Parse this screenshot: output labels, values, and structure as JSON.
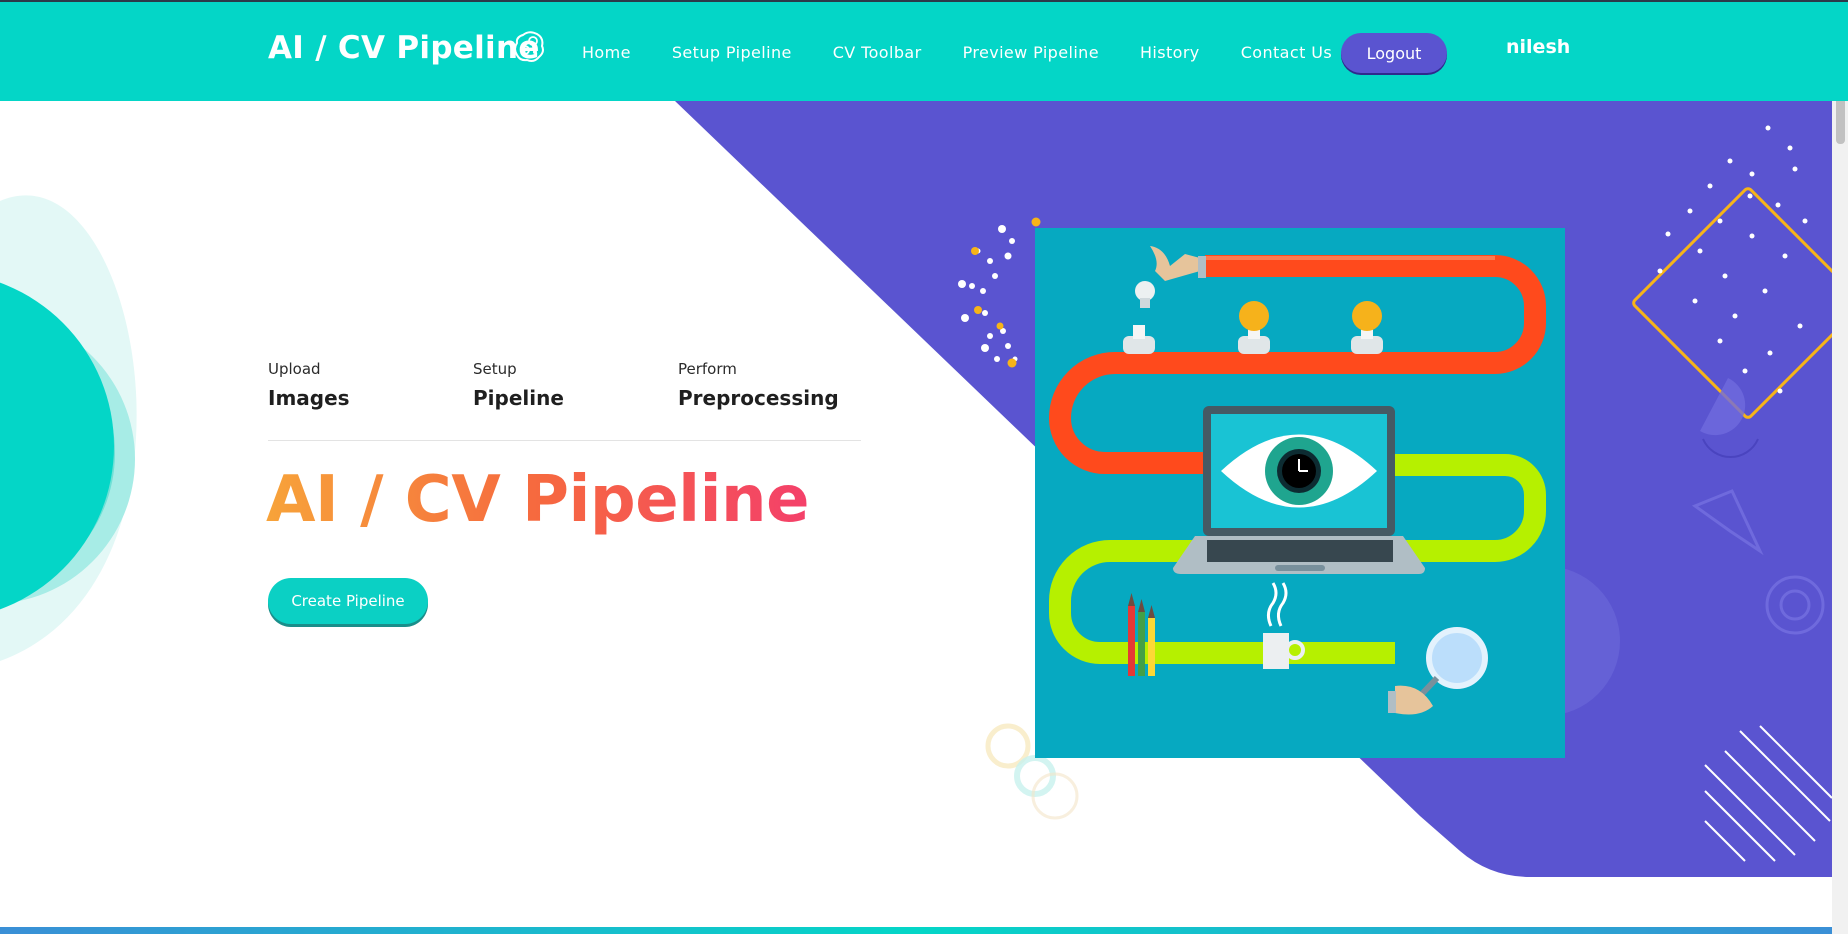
{
  "header": {
    "brand": "AI / CV Pipeline",
    "brand_icon": "brain-gear-icon",
    "nav": [
      {
        "label": "Home"
      },
      {
        "label": "Setup Pipeline"
      },
      {
        "label": "CV Toolbar"
      },
      {
        "label": "Preview Pipeline"
      },
      {
        "label": "History"
      },
      {
        "label": "Contact Us"
      }
    ],
    "logout_label": "Logout",
    "username": "nilesh"
  },
  "hero": {
    "features": [
      {
        "small": "Upload",
        "big": "Images"
      },
      {
        "small": "Setup",
        "big": "Pipeline"
      },
      {
        "small": "Perform",
        "big": "Preprocessing"
      }
    ],
    "title": "AI / CV Pipeline",
    "cta_label": "Create Pipeline",
    "illustration": "pipeline-illustration-eye-laptop"
  },
  "colors": {
    "primary_teal": "#04d6c7",
    "accent_purple": "#5a54d0",
    "gradient_start": "#f7a33a",
    "gradient_end": "#f4406a",
    "illustration_bg": "#06a9c1"
  }
}
